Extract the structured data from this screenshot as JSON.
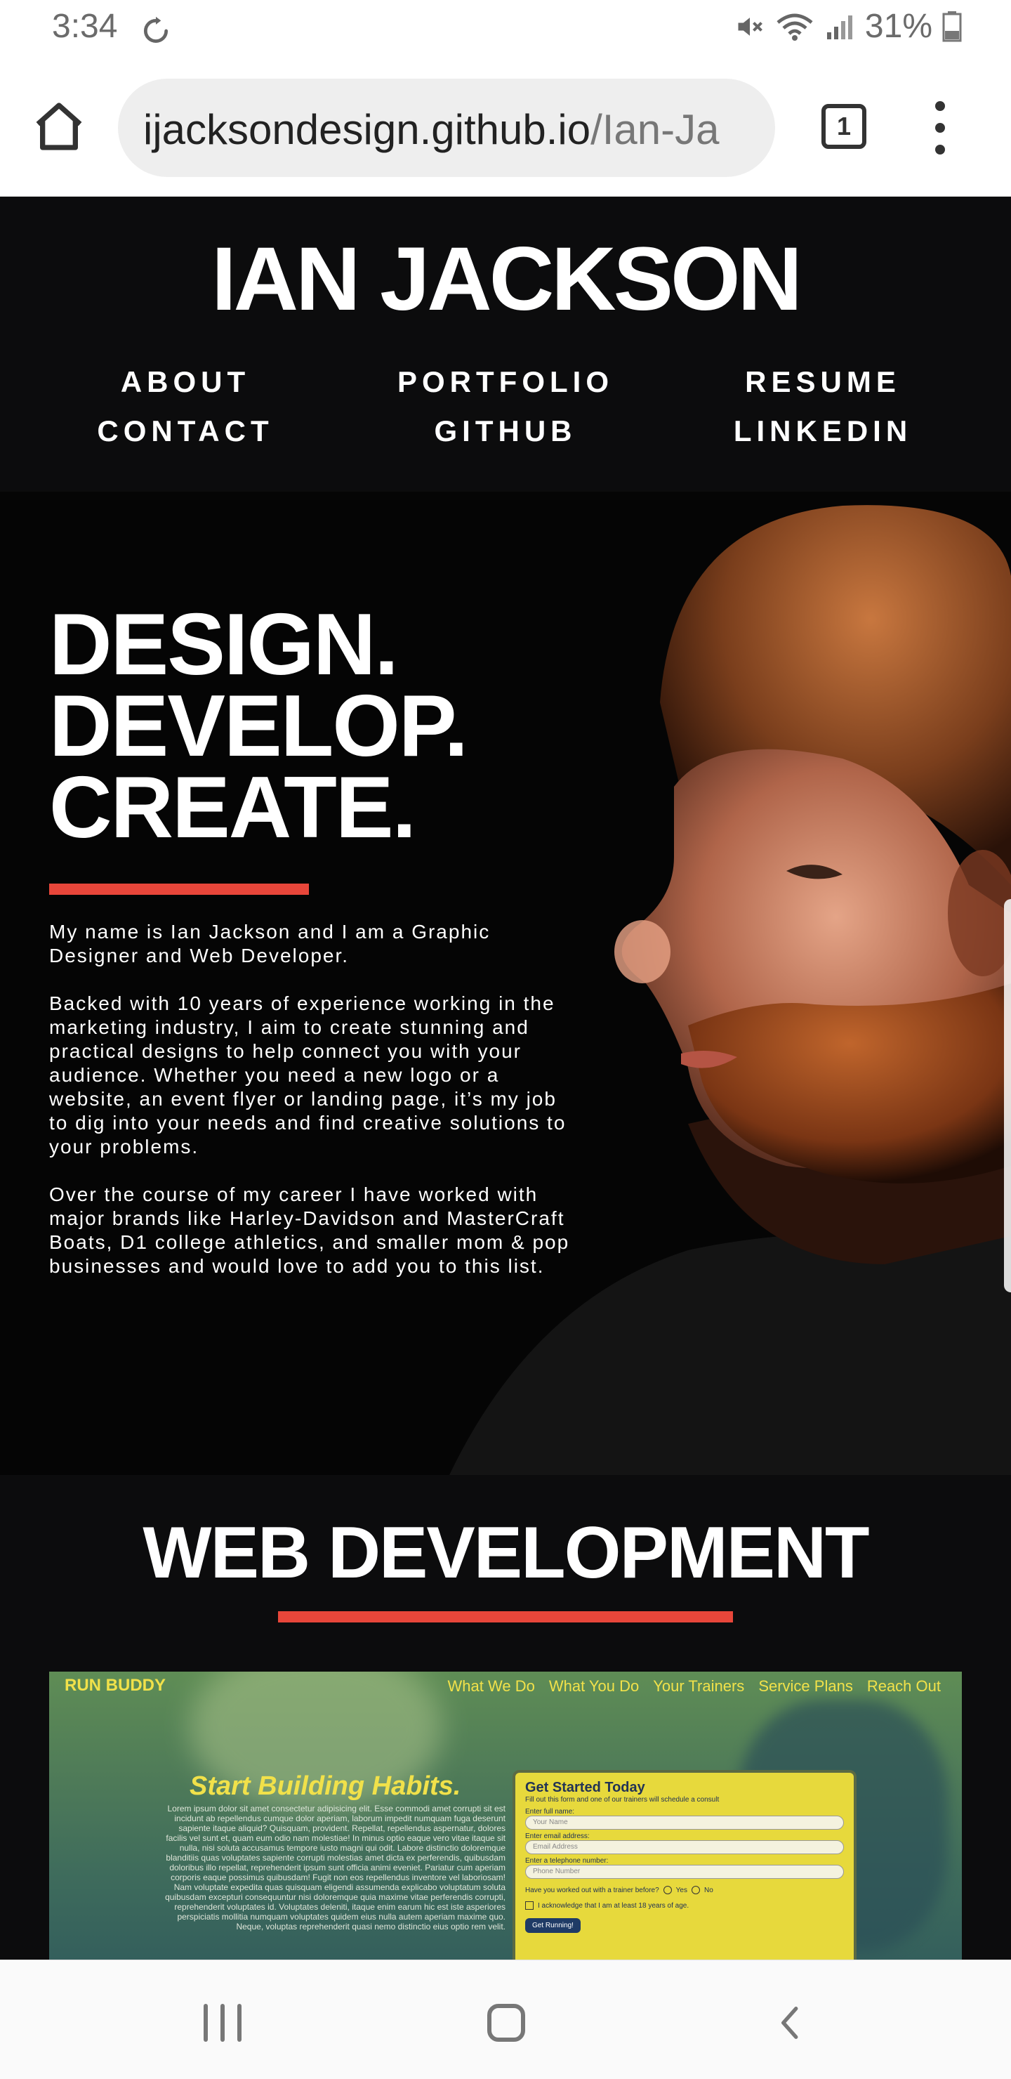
{
  "status_bar": {
    "time": "3:34",
    "battery": "31%"
  },
  "browser": {
    "url_main": "ijacksondesign.github.io",
    "url_rest": "/Ian-Ja",
    "tab_count": "1"
  },
  "header": {
    "title": "IAN JACKSON",
    "nav": [
      "ABOUT",
      "PORTFOLIO",
      "RESUME",
      "CONTACT",
      "GITHUB",
      "LINKEDIN"
    ]
  },
  "hero": {
    "headline": [
      "DESIGN.",
      "DEVELOP.",
      "CREATE."
    ],
    "paragraphs": [
      "My name is Ian Jackson and I am a Graphic Designer and Web Developer.",
      "Backed with 10 years of experience working in the marketing industry, I aim to create stunning and practical designs to help connect you with your audience. Whether you need a new logo or a website, an event flyer or landing page, it’s my job to dig into your needs and find creative solutions to your problems.",
      "Over the course of my career I have worked with major brands like Harley-Davidson and MasterCraft Boats, D1 college athletics, and smaller mom & pop businesses and would love to add you to this list."
    ]
  },
  "web_dev": {
    "title": "WEB DEVELOPMENT",
    "project": {
      "brand": "RUN BUDDY",
      "nav": [
        "What We Do",
        "What You Do",
        "Your Trainers",
        "Service Plans",
        "Reach Out"
      ],
      "heading": "Start Building Habits.",
      "lorem": "Lorem ipsum dolor sit amet consectetur adipisicing elit. Esse commodi amet corrupti sit est incidunt ab repellendus cumque dolor aperiam, laborum impedit numquam fuga deserunt sapiente itaque aliquid? Quisquam, provident. Repellat, repellendus aspernatur, dolores facilis vel sunt et, quam eum odio nam molestiae! In minus optio eaque vero vitae itaque sit nulla, nisi soluta accusamus tempore iusto magni qui odit. Labore distinctio doloremque blanditiis quas voluptates sapiente corrupti molestias amet dicta ex perferendis, quibusdam doloribus illo repellat, reprehenderit ipsum sunt officia animi eveniet. Pariatur cum aperiam corporis eaque possimus quibusdam! Fugit non eos repellendus inventore vel laboriosam! Nam voluptate expedita quas quisquam eligendi assumenda explicabo voluptatum soluta quibusdam excepturi consequuntur nisi doloremque quia maxime vitae perferendis corrupti, reprehenderit voluptates id. Voluptates deleniti, itaque enim earum hic est iste asperiores perspiciatis mollitia numquam voluptates quidem eius nulla autem aperiam maxime quo. Neque, voluptas reprehenderit quasi nemo distinctio eius optio rem velit.",
      "form": {
        "title": "Get Started Today",
        "subtitle": "Fill out this form and one of our trainers will schedule a consult",
        "name_label": "Enter full name:",
        "name_placeholder": "Your Name",
        "email_label": "Enter email address:",
        "email_placeholder": "Email Address",
        "phone_label": "Enter a telephone number:",
        "phone_placeholder": "Phone Number",
        "question": "Have you worked out with a trainer before?",
        "yes": "Yes",
        "no": "No",
        "ack": "I acknowledge that I am at least 18 years of age.",
        "button": "Get Running!"
      }
    }
  },
  "colors": {
    "accent": "#e8463a",
    "header_bg": "#0c0c0d",
    "hero_bg": "#050505",
    "project_accent": "#f1e14a"
  }
}
